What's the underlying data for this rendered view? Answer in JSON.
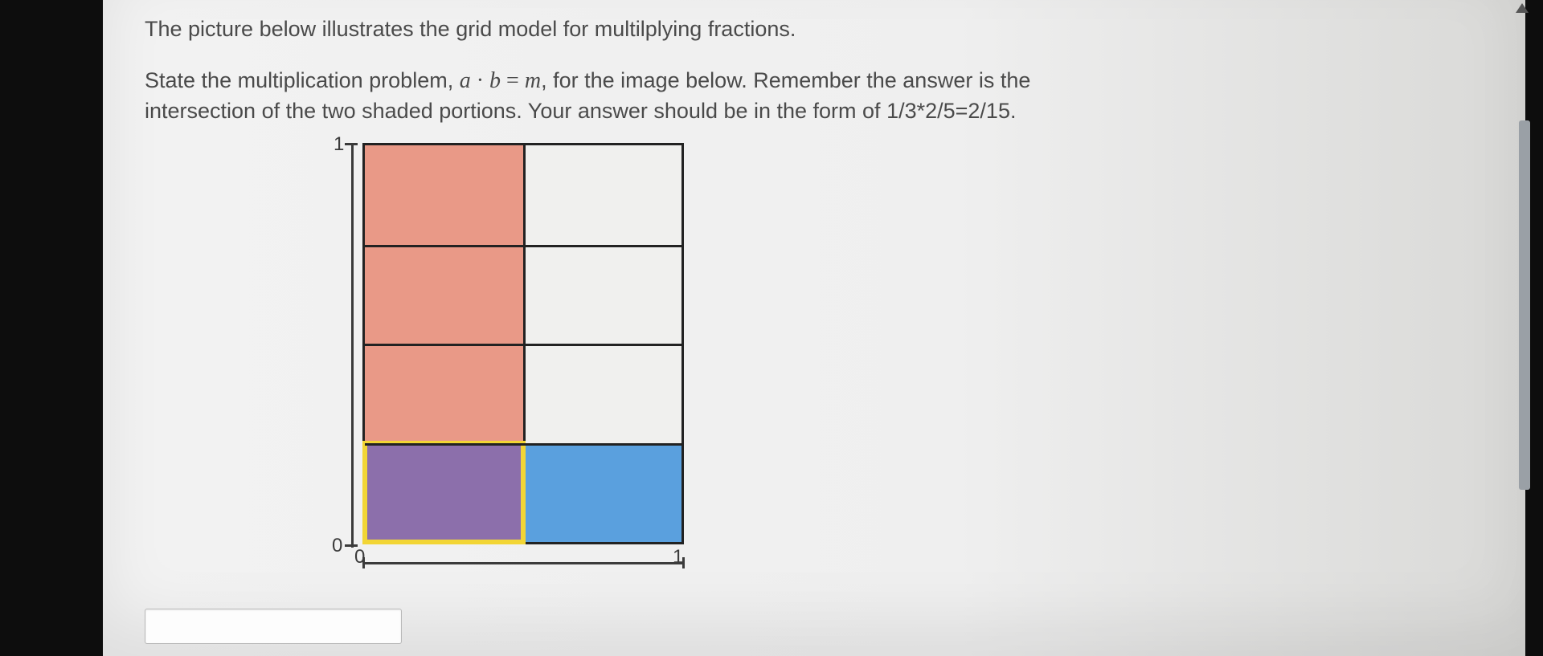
{
  "intro_text": "The picture below illustrates the grid model for multilplying fractions.",
  "prompt_lead": "State the multiplication problem, ",
  "math_a": "a",
  "math_dot": " · ",
  "math_b": "b",
  "math_eq": " = ",
  "math_m": "m",
  "prompt_mid": ", for the image below. Remember the answer is the",
  "prompt_line2": "intersection of the two shaded portions. Your answer should be in the form of 1/3*2/5=2/15.",
  "axis": {
    "y_top": "1",
    "y_bottom": "0",
    "x_left": "0",
    "x_right": "1"
  },
  "answer": {
    "value": "",
    "placeholder": ""
  },
  "chart_data": {
    "type": "area",
    "title": "Grid model for multiplying fractions",
    "xlabel": "",
    "ylabel": "",
    "xlim": [
      0,
      1
    ],
    "ylim": [
      0,
      1
    ],
    "grid": {
      "x_splits": [
        0.5
      ],
      "y_splits": [
        0.25,
        0.5,
        0.75
      ]
    },
    "regions": [
      {
        "name": "vertical-shade (pink, fraction a column extended)",
        "x": [
          0,
          0.5
        ],
        "y": [
          0.25,
          1
        ],
        "color": "#e99987"
      },
      {
        "name": "horizontal-shade-right (blue, fraction b row)",
        "x": [
          0.5,
          1
        ],
        "y": [
          0,
          0.25
        ],
        "color": "#5aa0de"
      },
      {
        "name": "intersection (purple, a·b)",
        "x": [
          0,
          0.5
        ],
        "y": [
          0,
          0.25
        ],
        "color": "#8c6fab",
        "outline": "#f2d535"
      }
    ],
    "implied_fractions": {
      "a_horizontal": "1/2",
      "b_vertical": "1/4",
      "product": "1/8"
    }
  }
}
